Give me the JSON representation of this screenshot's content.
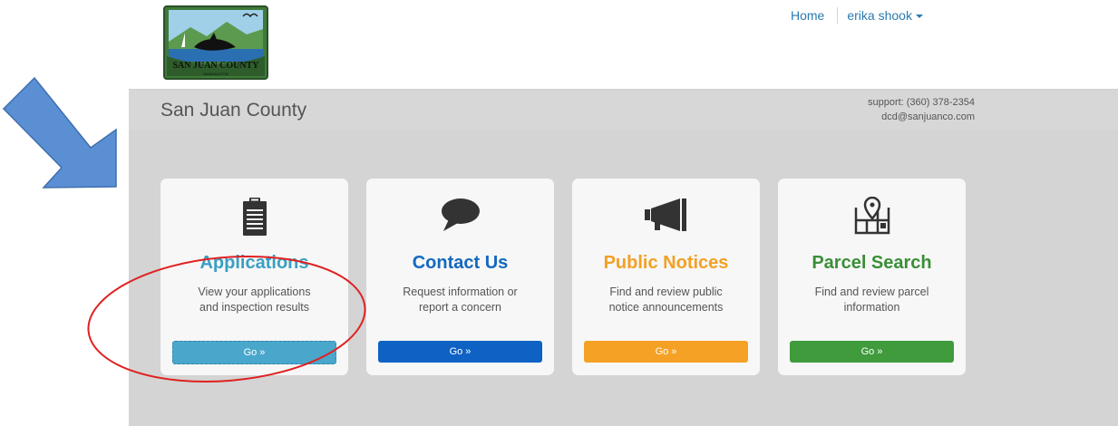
{
  "logo": {
    "text": "SAN JUAN COUNTY",
    "subtext": "WASHINGTON"
  },
  "topnav": {
    "home": "Home",
    "user": "erika shook"
  },
  "header": {
    "title": "San Juan County",
    "support_phone": "support: (360) 378-2354",
    "support_email": "dcd@sanjuanco.com"
  },
  "cards": [
    {
      "title": "Applications",
      "desc1": "View your applications",
      "desc2": "and inspection results",
      "button": "Go »",
      "color": "#3a9fc4",
      "icon": "clipboard-icon"
    },
    {
      "title": "Contact Us",
      "desc1": "Request information or",
      "desc2": "report a concern",
      "button": "Go »",
      "color": "#0d62c4",
      "icon": "speech-bubble-icon"
    },
    {
      "title": "Public Notices",
      "desc1": "Find and review public",
      "desc2": "notice announcements",
      "button": "Go »",
      "color": "#f3a024",
      "icon": "megaphone-icon"
    },
    {
      "title": "Parcel Search",
      "desc1": "Find and review parcel",
      "desc2": "information",
      "button": "Go »",
      "color": "#3f9b3c",
      "icon": "map-pin-icon"
    }
  ],
  "colors": {
    "arrow": "#5b8fd4",
    "highlight_oval": "#e02020",
    "header_bg": "#d7d7d7"
  }
}
